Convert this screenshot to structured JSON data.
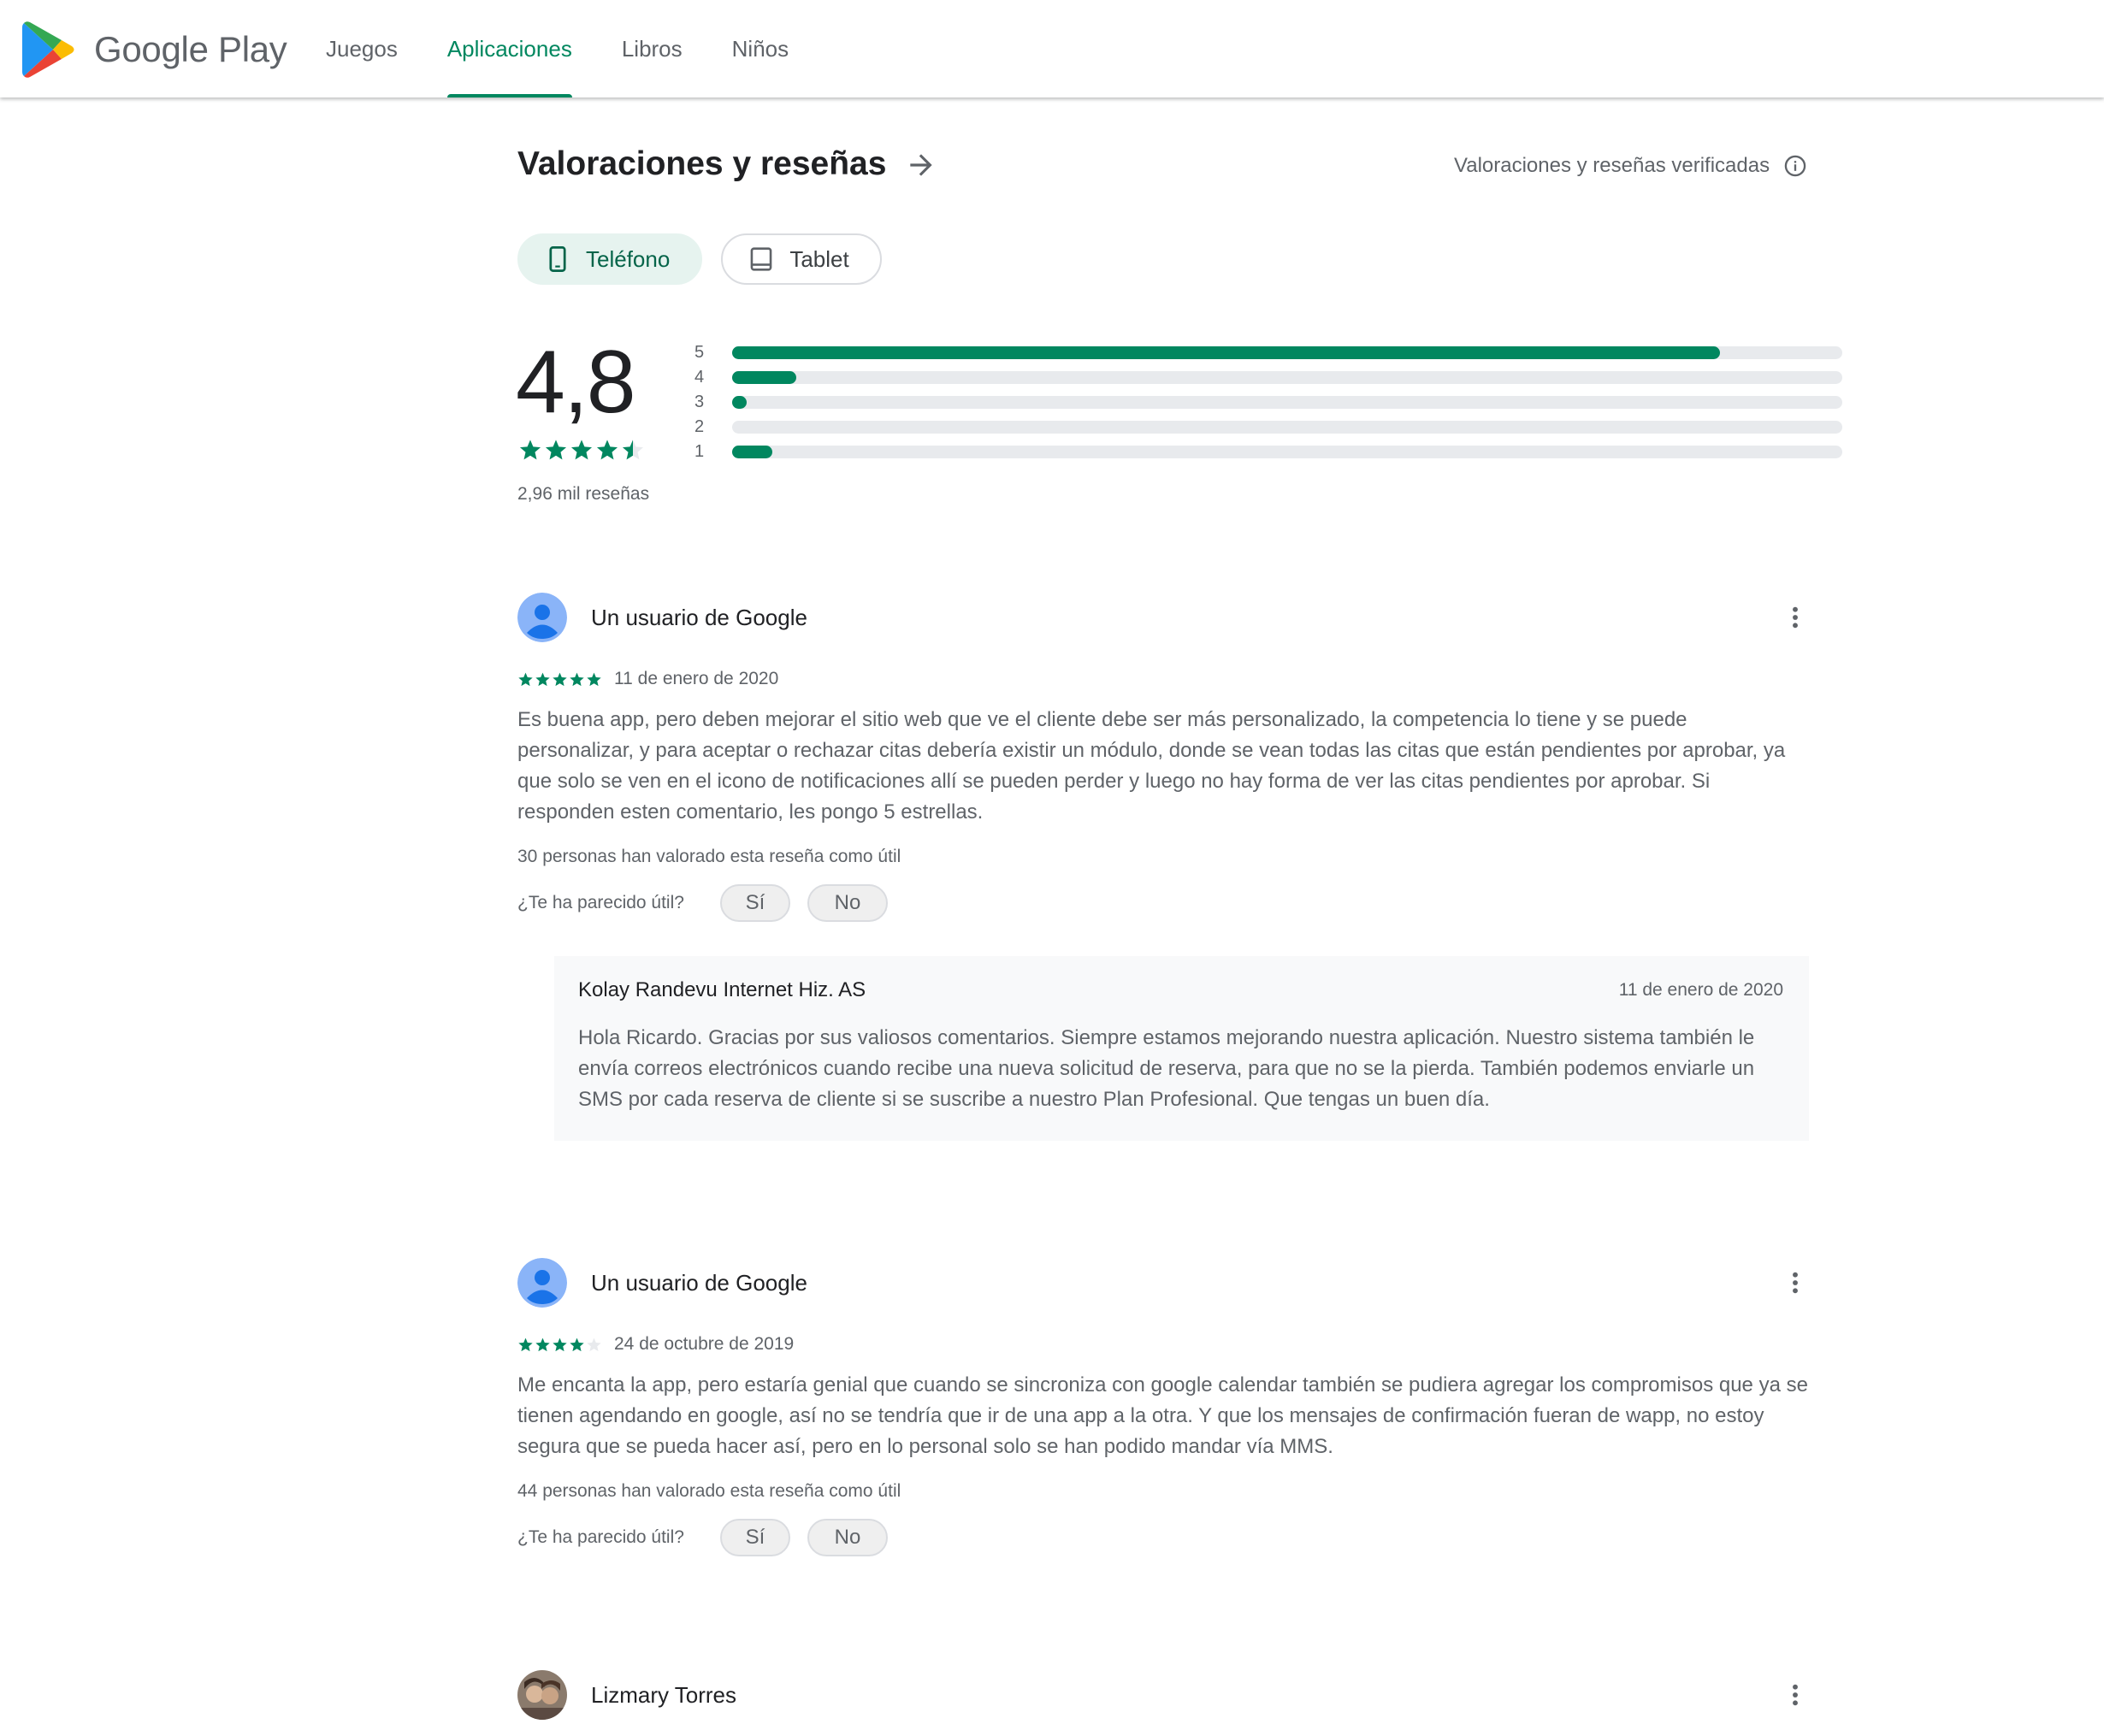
{
  "header": {
    "brand": "Google Play",
    "nav": [
      {
        "label": "Juegos",
        "active": false
      },
      {
        "label": "Aplicaciones",
        "active": true
      },
      {
        "label": "Libros",
        "active": false
      },
      {
        "label": "Niños",
        "active": false
      }
    ],
    "accent_color": "#01875f"
  },
  "ratings": {
    "title": "Valoraciones y reseñas",
    "verified_label": "Valoraciones y reseñas verificadas",
    "devices": [
      {
        "label": "Teléfono",
        "icon": "phone-icon",
        "selected": true
      },
      {
        "label": "Tablet",
        "icon": "tablet-icon",
        "selected": false
      }
    ],
    "average": "4,8",
    "average_stars": 4.5,
    "count_label": "2,96 mil reseñas",
    "histogram": [
      {
        "stars": "5",
        "fraction": 0.89
      },
      {
        "stars": "4",
        "fraction": 0.058
      },
      {
        "stars": "3",
        "fraction": 0.013
      },
      {
        "stars": "2",
        "fraction": 0.0
      },
      {
        "stars": "1",
        "fraction": 0.036
      }
    ]
  },
  "reviews": [
    {
      "author": "Un usuario de Google",
      "avatar": "default-user-avatar",
      "stars": 5,
      "date": "11 de enero de 2020",
      "text": "Es buena app, pero deben mejorar el sitio web que ve el cliente debe ser más personalizado, la competencia lo tiene y se puede personalizar, y para aceptar o rechazar citas debería existir un módulo, donde se vean todas las citas que están pendientes por aprobar, ya que solo se ven en el icono de notificaciones allí se pueden perder y luego no hay forma de ver las citas pendientes por aprobar. Si responden esten comentario, les pongo 5 estrellas.",
      "helpful_count": "30 personas han valorado esta reseña como útil",
      "helpful_question": "¿Te ha parecido útil?",
      "yes_label": "Sí",
      "no_label": "No",
      "reply": {
        "author": "Kolay Randevu Internet Hiz. AS",
        "date": "11 de enero de 2020",
        "text": "Hola Ricardo. Gracias por sus valiosos comentarios. Siempre estamos mejorando nuestra aplicación. Nuestro sistema también le envía correos electrónicos cuando recibe una nueva solicitud de reserva, para que no se la pierda. También podemos enviarle un SMS por cada reserva de cliente si se suscribe a nuestro Plan Profesional. Que tengas un buen día."
      }
    },
    {
      "author": "Un usuario de Google",
      "avatar": "default-user-avatar",
      "stars": 4,
      "date": "24 de octubre de 2019",
      "text": "Me encanta la app, pero estaría genial que cuando se sincroniza con google calendar también se pudiera agregar los compromisos que ya se tienen agendando en google, así no se tendría que ir de una app a la otra. Y que los mensajes de confirmación fueran de wapp, no estoy segura que se pueda hacer así, pero en lo personal solo se han podido mandar vía MMS.",
      "helpful_count": "44 personas han valorado esta reseña como útil",
      "helpful_question": "¿Te ha parecido útil?",
      "yes_label": "Sí",
      "no_label": "No"
    },
    {
      "author": "Lizmary Torres",
      "avatar": "photo-avatar"
    }
  ]
}
